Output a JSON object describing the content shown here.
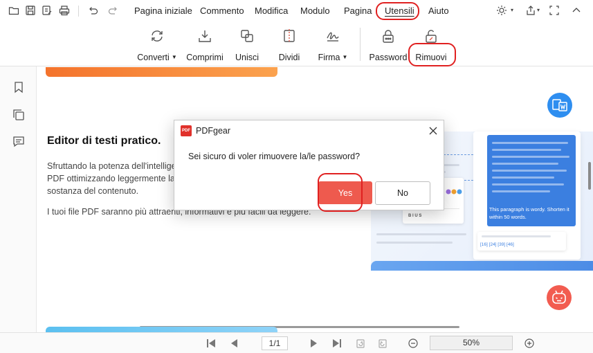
{
  "menu": {
    "items": [
      "Pagina iniziale",
      "Commento",
      "Modifica",
      "Modulo",
      "Pagina",
      "Utensili",
      "Aiuto"
    ],
    "active": "Utensili"
  },
  "ribbon": {
    "tools": [
      {
        "label": "Converti",
        "icon": "convert-icon",
        "dropdown": true
      },
      {
        "label": "Comprimi",
        "icon": "compress-icon",
        "dropdown": false
      },
      {
        "label": "Unisci",
        "icon": "merge-icon",
        "dropdown": false
      },
      {
        "label": "Dividi",
        "icon": "split-icon",
        "dropdown": false
      },
      {
        "label": "Firma",
        "icon": "signature-icon",
        "dropdown": true
      },
      {
        "label": "Password",
        "icon": "lock-icon",
        "dropdown": false
      },
      {
        "label": "Rimuovi",
        "icon": "unlock-icon",
        "dropdown": false
      }
    ]
  },
  "document": {
    "heading": "Editor di testi pratico.",
    "paragraph1_lines": [
      "Sfruttando la potenza dell'intelligen",
      "PDF ottimizzando leggermente la f",
      "sostanza del contenuto."
    ],
    "paragraph2": "I tuoi file PDF saranno più attraenti, informativi e più facili da leggere.",
    "illustration": {
      "card_text": "This paragraph is wordy. Shorten it within 50 words.",
      "refs": "[16] [24] [39] [46]"
    }
  },
  "dialog": {
    "app_name": "PDFgear",
    "logo_text": "PDF",
    "message": "Sei sicuro di voler rimuovere la/le password?",
    "yes_label": "Yes",
    "no_label": "No"
  },
  "status": {
    "page_display": "1/1",
    "zoom": "50%"
  },
  "colors": {
    "accent_red": "#e02020",
    "primary_button": "#ee5a4e",
    "fab_blue": "#2e8ef0",
    "fab_red": "#f25c50"
  }
}
